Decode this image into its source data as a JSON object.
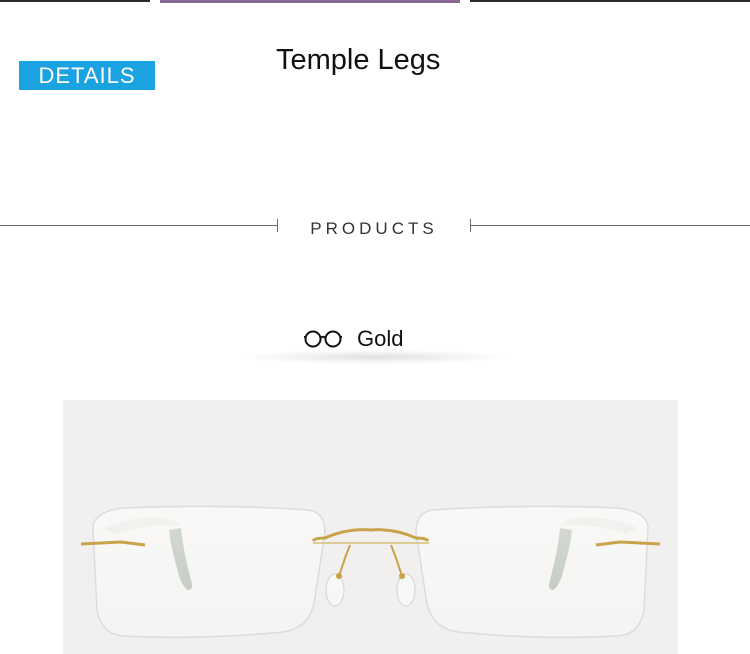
{
  "header": {
    "badge_label": "DETAILS",
    "title": "Temple Legs"
  },
  "divider": {
    "label": "PRODUCTS"
  },
  "color_option": {
    "icon": "glasses-icon",
    "label": "Gold"
  },
  "product_image": {
    "subject": "rimless-eyeglasses-gold-frame"
  },
  "colors": {
    "badge": "#1aa3e0",
    "divider": "#6a6a6a",
    "frame_gold": "#c9a34a",
    "temple_tip": "#a7b0a6",
    "photo_background": "#f1f0ee"
  }
}
